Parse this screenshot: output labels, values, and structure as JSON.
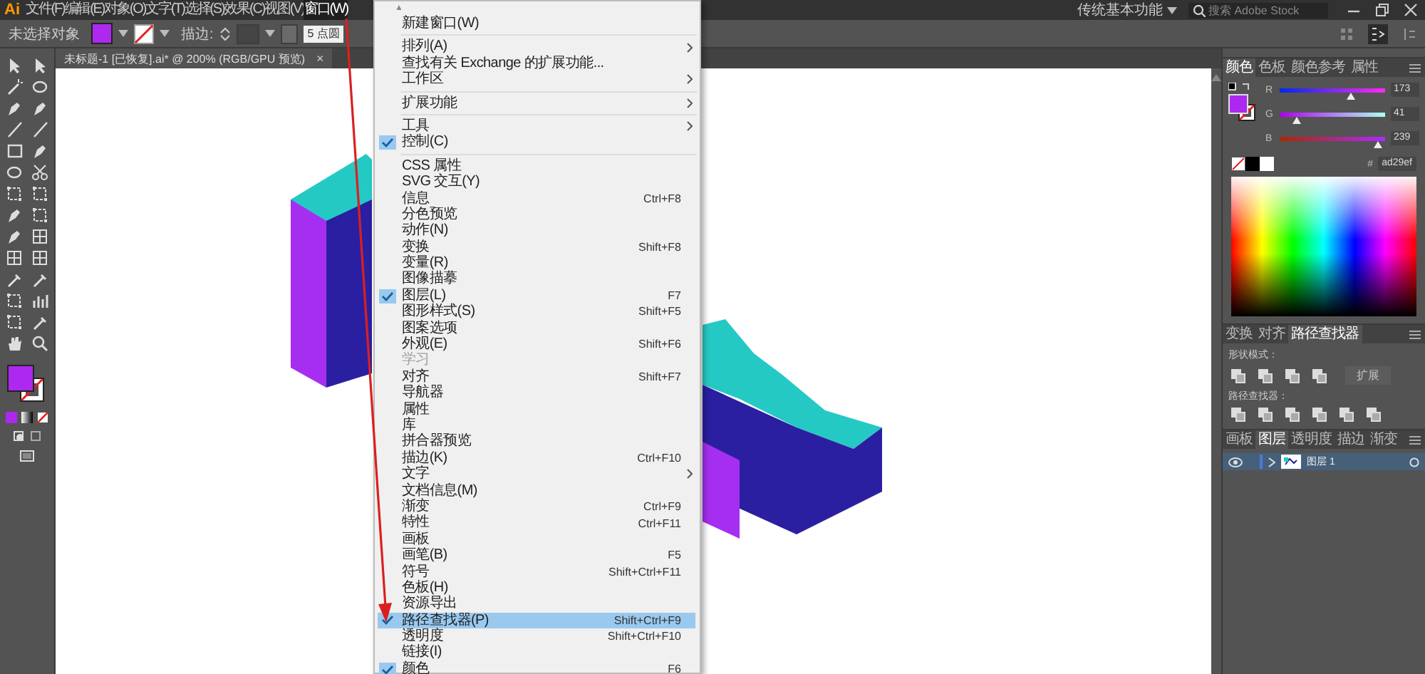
{
  "menubar": {
    "logo": "Ai",
    "items": [
      {
        "label": "文件(F)",
        "selected": false
      },
      {
        "label": "编辑(E)",
        "selected": false
      },
      {
        "label": "对象(O)",
        "selected": false
      },
      {
        "label": "文字(T)",
        "selected": false
      },
      {
        "label": "选择(S)",
        "selected": false
      },
      {
        "label": "效果(C)",
        "selected": false
      },
      {
        "label": "视图(V)",
        "selected": false
      },
      {
        "label": "窗口(W)",
        "selected": true
      }
    ],
    "workspace": "传统基本功能",
    "search": {
      "placeholder": "搜索 Adobe Stock"
    }
  },
  "control_bar": {
    "selection": "未选择对象",
    "stroke_label": "描边:",
    "brush": "5 点圆"
  },
  "document_tab": {
    "title": "未标题-1 [已恢复].ai* @ 200% (RGB/GPU 预览)",
    "close": "×"
  },
  "window_menu": {
    "scroll_up": "▲",
    "items": [
      {
        "kind": "item",
        "label": "新建窗口(W)",
        "checked": false,
        "selected": false,
        "disabled": false
      },
      {
        "kind": "separator"
      },
      {
        "kind": "submenu",
        "label": "排列(A)",
        "checked": false,
        "selected": false,
        "disabled": false
      },
      {
        "kind": "item",
        "label": "查找有关 Exchange 的扩展功能...",
        "checked": false,
        "selected": false,
        "disabled": false
      },
      {
        "kind": "submenu",
        "label": "工作区",
        "checked": false,
        "selected": false,
        "disabled": false
      },
      {
        "kind": "separator"
      },
      {
        "kind": "submenu",
        "label": "扩展功能",
        "checked": false,
        "selected": false,
        "disabled": false
      },
      {
        "kind": "separator"
      },
      {
        "kind": "submenu",
        "label": "工具",
        "checked": false,
        "selected": false,
        "disabled": false
      },
      {
        "kind": "item",
        "label": "控制(C)",
        "checked": true,
        "selected": false,
        "disabled": false
      },
      {
        "kind": "separator"
      },
      {
        "kind": "item",
        "label": "CSS 属性",
        "checked": false,
        "selected": false,
        "disabled": false
      },
      {
        "kind": "item",
        "label": "SVG 交互(Y)",
        "checked": false,
        "selected": false,
        "disabled": false
      },
      {
        "kind": "item",
        "label": "信息",
        "shortcut": "Ctrl+F8",
        "checked": false,
        "selected": false,
        "disabled": false
      },
      {
        "kind": "item",
        "label": "分色预览",
        "checked": false,
        "selected": false,
        "disabled": false
      },
      {
        "kind": "item",
        "label": "动作(N)",
        "checked": false,
        "selected": false,
        "disabled": false
      },
      {
        "kind": "item",
        "label": "变换",
        "shortcut": "Shift+F8",
        "checked": false,
        "selected": false,
        "disabled": false
      },
      {
        "kind": "item",
        "label": "变量(R)",
        "checked": false,
        "selected": false,
        "disabled": false
      },
      {
        "kind": "item",
        "label": "图像描摹",
        "checked": false,
        "selected": false,
        "disabled": false
      },
      {
        "kind": "item",
        "label": "图层(L)",
        "shortcut": "F7",
        "checked": true,
        "selected": false,
        "disabled": false
      },
      {
        "kind": "item",
        "label": "图形样式(S)",
        "shortcut": "Shift+F5",
        "checked": false,
        "selected": false,
        "disabled": false
      },
      {
        "kind": "item",
        "label": "图案选项",
        "checked": false,
        "selected": false,
        "disabled": false
      },
      {
        "kind": "item",
        "label": "外观(E)",
        "shortcut": "Shift+F6",
        "checked": false,
        "selected": false,
        "disabled": false
      },
      {
        "kind": "item",
        "label": "学习",
        "checked": false,
        "selected": false,
        "disabled": true
      },
      {
        "kind": "item",
        "label": "对齐",
        "shortcut": "Shift+F7",
        "checked": false,
        "selected": false,
        "disabled": false
      },
      {
        "kind": "item",
        "label": "导航器",
        "checked": false,
        "selected": false,
        "disabled": false
      },
      {
        "kind": "item",
        "label": "属性",
        "checked": false,
        "selected": false,
        "disabled": false
      },
      {
        "kind": "item",
        "label": "库",
        "checked": false,
        "selected": false,
        "disabled": false
      },
      {
        "kind": "item",
        "label": "拼合器预览",
        "checked": false,
        "selected": false,
        "disabled": false
      },
      {
        "kind": "item",
        "label": "描边(K)",
        "shortcut": "Ctrl+F10",
        "checked": false,
        "selected": false,
        "disabled": false
      },
      {
        "kind": "submenu",
        "label": "文字",
        "checked": false,
        "selected": false,
        "disabled": false
      },
      {
        "kind": "item",
        "label": "文档信息(M)",
        "checked": false,
        "selected": false,
        "disabled": false
      },
      {
        "kind": "item",
        "label": "渐变",
        "shortcut": "Ctrl+F9",
        "checked": false,
        "selected": false,
        "disabled": false
      },
      {
        "kind": "item",
        "label": "特性",
        "shortcut": "Ctrl+F11",
        "checked": false,
        "selected": false,
        "disabled": false
      },
      {
        "kind": "item",
        "label": "画板",
        "checked": false,
        "selected": false,
        "disabled": false
      },
      {
        "kind": "item",
        "label": "画笔(B)",
        "shortcut": "F5",
        "checked": false,
        "selected": false,
        "disabled": false
      },
      {
        "kind": "item",
        "label": "符号",
        "shortcut": "Shift+Ctrl+F11",
        "checked": false,
        "selected": false,
        "disabled": false
      },
      {
        "kind": "item",
        "label": "色板(H)",
        "checked": false,
        "selected": false,
        "disabled": false
      },
      {
        "kind": "item",
        "label": "资源导出",
        "checked": false,
        "selected": false,
        "disabled": false
      },
      {
        "kind": "item",
        "label": "路径查找器(P)",
        "shortcut": "Shift+Ctrl+F9",
        "checked": true,
        "selected": true,
        "disabled": false
      },
      {
        "kind": "item",
        "label": "透明度",
        "shortcut": "Shift+Ctrl+F10",
        "checked": false,
        "selected": false,
        "disabled": false
      },
      {
        "kind": "item",
        "label": "链接(I)",
        "checked": false,
        "selected": false,
        "disabled": false
      },
      {
        "kind": "item",
        "label": "颜色",
        "shortcut": "F6",
        "checked": true,
        "selected": false,
        "disabled": false
      }
    ]
  },
  "color_panel": {
    "tabs": [
      {
        "label": "颜色",
        "selected": true
      },
      {
        "label": "色板",
        "selected": false
      },
      {
        "label": "颜色参考",
        "selected": false
      },
      {
        "label": "属性",
        "selected": false
      }
    ],
    "channels": [
      {
        "label": "R",
        "level": 0.678,
        "value": "173"
      },
      {
        "label": "G",
        "level": 0.161,
        "value": "41"
      },
      {
        "label": "B",
        "level": 0.937,
        "value": "239"
      }
    ],
    "hex_label": "#",
    "hex": "ad29ef"
  },
  "pathfinder_panel": {
    "tabs": [
      {
        "label": "变换",
        "selected": false
      },
      {
        "label": "对齐",
        "selected": false
      },
      {
        "label": "路径查找器",
        "selected": true
      }
    ],
    "shape_modes_label": "形状模式：",
    "expand_button": {
      "label": "扩展",
      "disabled": true
    },
    "pathfinders_label": "路径查找器："
  },
  "layers_panel": {
    "tabs": [
      {
        "label": "画板",
        "selected": false
      },
      {
        "label": "图层",
        "selected": true
      },
      {
        "label": "透明度",
        "selected": false
      },
      {
        "label": "描边",
        "selected": false
      },
      {
        "label": "渐变",
        "selected": false
      }
    ],
    "layers": [
      {
        "name": "图层 1",
        "selected": true,
        "visible": true,
        "expanded": false
      }
    ]
  }
}
